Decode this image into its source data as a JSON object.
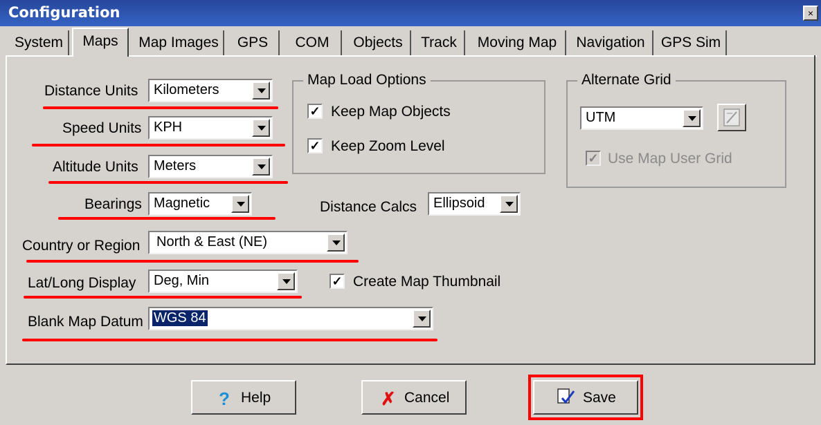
{
  "window": {
    "title": "Configuration",
    "close_label": "×"
  },
  "tabs": [
    {
      "label": "System"
    },
    {
      "label": "Maps"
    },
    {
      "label": "Map Images"
    },
    {
      "label": "GPS"
    },
    {
      "label": "COM"
    },
    {
      "label": "Objects"
    },
    {
      "label": "Track"
    },
    {
      "label": "Moving Map"
    },
    {
      "label": "Navigation"
    },
    {
      "label": "GPS Sim"
    }
  ],
  "fields": {
    "distance_units": {
      "label": "Distance Units",
      "value": "Kilometers"
    },
    "speed_units": {
      "label": "Speed Units",
      "value": "KPH"
    },
    "altitude_units": {
      "label": "Altitude Units",
      "value": "Meters"
    },
    "bearings": {
      "label": "Bearings",
      "value": "Magnetic"
    },
    "distance_calcs": {
      "label": "Distance Calcs",
      "value": "Ellipsoid"
    },
    "country_region": {
      "label": "Country or Region",
      "value": "North & East (NE)"
    },
    "latlong_display": {
      "label": "Lat/Long Display",
      "value": "Deg, Min"
    },
    "blank_map_datum": {
      "label": "Blank Map Datum",
      "value": "WGS 84"
    }
  },
  "map_load_options": {
    "title": "Map Load Options",
    "keep_map_objects": {
      "label": "Keep Map Objects",
      "checked": true
    },
    "keep_zoom_level": {
      "label": "Keep Zoom Level",
      "checked": true
    }
  },
  "alternate_grid": {
    "title": "Alternate Grid",
    "value": "UTM",
    "use_map_user_grid": {
      "label": "Use Map User Grid",
      "checked": true,
      "disabled": true
    }
  },
  "create_map_thumbnail": {
    "label": "Create Map Thumbnail",
    "checked": true
  },
  "buttons": {
    "help": "Help",
    "cancel": "Cancel",
    "save": "Save"
  },
  "check_glyph": "✓",
  "colors": {
    "title_bar": "#27479c",
    "dialog_bg": "#d6d3ce",
    "annotation_red": "#ff0000",
    "selection": "#0a246a"
  }
}
